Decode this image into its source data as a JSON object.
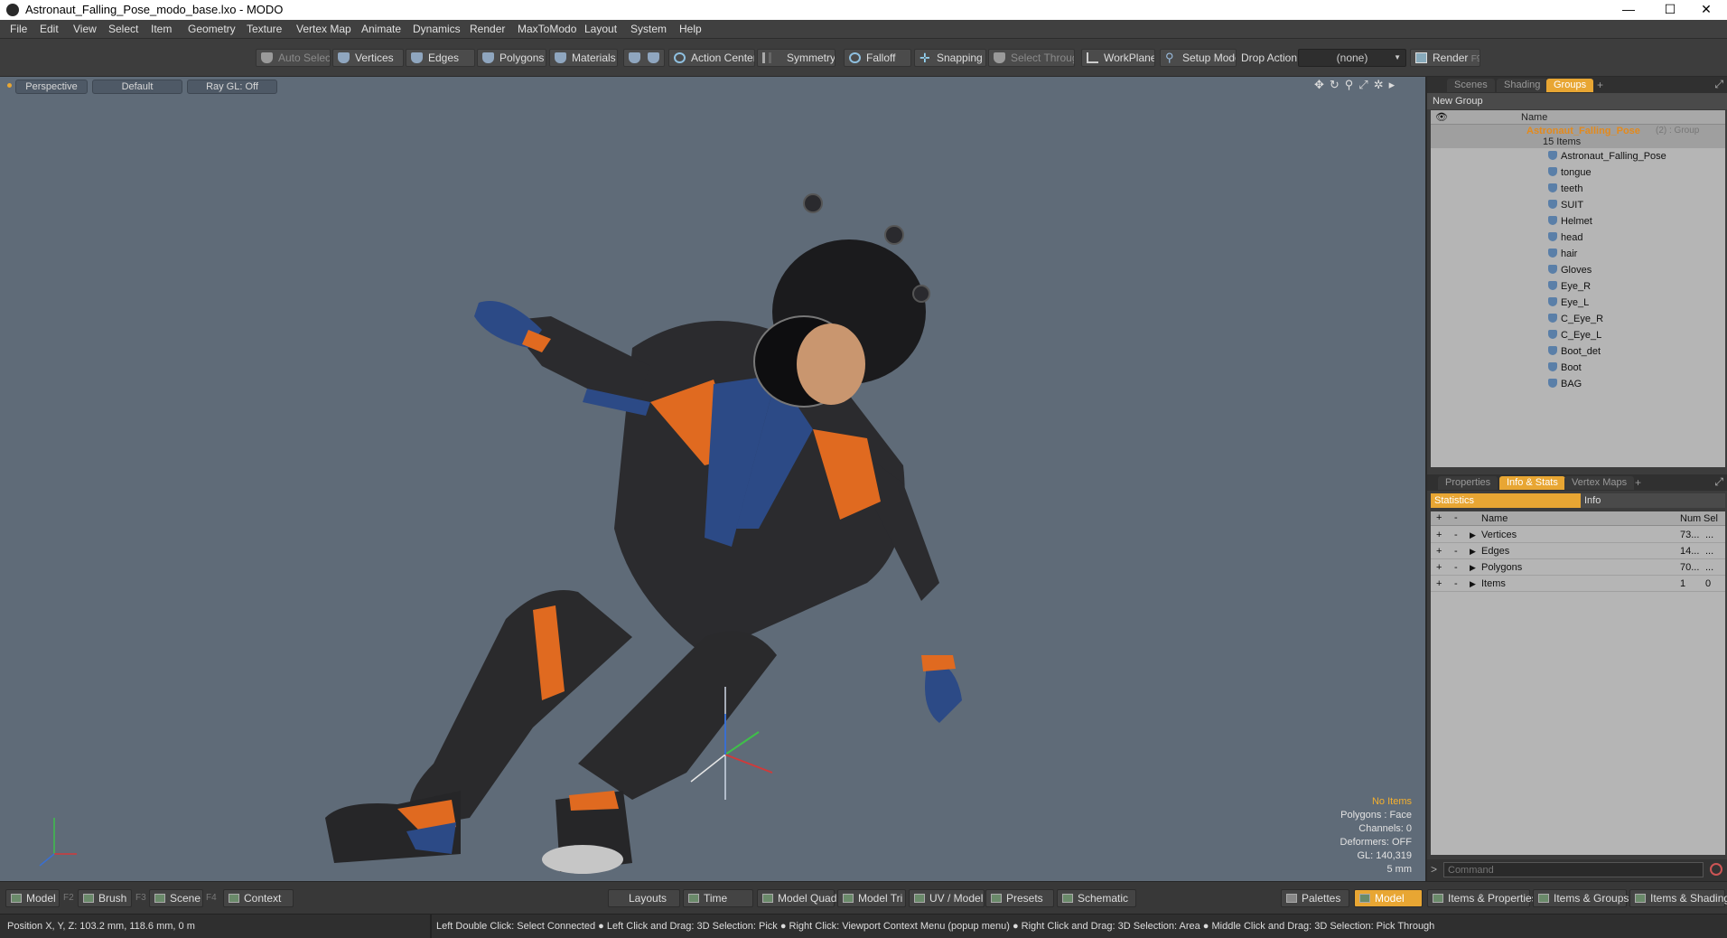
{
  "window": {
    "title": "Astronaut_Falling_Pose_modo_base.lxo - MODO",
    "minimize": "—",
    "maximize": "☐",
    "close": "✕"
  },
  "menu": [
    "File",
    "Edit",
    "View",
    "Select",
    "Item",
    "Geometry",
    "Texture",
    "Vertex Map",
    "Animate",
    "Dynamics",
    "Render",
    "MaxToModo",
    "Layout",
    "System",
    "Help"
  ],
  "toolbar": {
    "auto_select": "Auto Select",
    "vertices": "Vertices",
    "edges": "Edges",
    "polygons": "Polygons",
    "materials": "Materials",
    "action_center": "Action Center",
    "symmetry": "Symmetry",
    "falloff": "Falloff",
    "snapping": "Snapping",
    "select_through": "Select Through",
    "workplane": "WorkPlane",
    "setup_mode": "Setup Mode",
    "drop_action": "Drop Action",
    "drop_value": "(none)",
    "render": "Render",
    "render_key": "F9"
  },
  "viewport": {
    "perspective": "Perspective",
    "default": "Default",
    "ray_gl": "Ray GL: Off",
    "stats": {
      "items": "No Items",
      "polygons": "Polygons : Face",
      "channels": "Channels: 0",
      "deformers": "Deformers: OFF",
      "gl": "GL: 140,319",
      "scale": "5 mm"
    }
  },
  "scene_panel": {
    "tabs": [
      "Scenes",
      "Shading",
      "Groups"
    ],
    "new_group": "New Group",
    "name_header": "Name",
    "group_name": "Astronaut_Falling_Pose",
    "group_suffix": "(2) : Group",
    "count": "15 Items",
    "items": [
      "Astronaut_Falling_Pose",
      "tongue",
      "teeth",
      "SUIT",
      "Helmet",
      "head",
      "hair",
      "Gloves",
      "Eye_R",
      "Eye_L",
      "C_Eye_R",
      "C_Eye_L",
      "Boot_det",
      "Boot",
      "BAG"
    ]
  },
  "props_panel": {
    "tabs": [
      "Properties",
      "Info & Stats",
      "Vertex Maps"
    ],
    "subtabs": [
      "Statistics",
      "Info"
    ],
    "headers": {
      "name": "Name",
      "num": "Num",
      "sel": "Sel"
    },
    "rows": [
      {
        "name": "Vertices",
        "num": "73...",
        "sel": "..."
      },
      {
        "name": "Edges",
        "num": "14...",
        "sel": "..."
      },
      {
        "name": "Polygons",
        "num": "70...",
        "sel": "..."
      },
      {
        "name": "Items",
        "num": "1",
        "sel": "0"
      }
    ],
    "command_placeholder": "Command"
  },
  "bottom": {
    "left": [
      {
        "label": "Model",
        "key": "F2"
      },
      {
        "label": "Brush",
        "key": "F3"
      },
      {
        "label": "Scene",
        "key": "F4"
      },
      {
        "label": "Context",
        "key": ""
      }
    ],
    "center": [
      "Layouts",
      "Time",
      "Model Quad",
      "Model Tri",
      "UV / Model",
      "Presets",
      "Schematic"
    ],
    "right": [
      "Palettes",
      "Model",
      "Items & Properties",
      "Items & Groups",
      "Items & Shading"
    ]
  },
  "status": {
    "position": "Position X, Y, Z:   103.2 mm, 118.6 mm, 0 m",
    "hint": "Left Double Click: Select Connected ● Left Click and Drag: 3D Selection: Pick ● Right Click: Viewport Context Menu (popup menu) ● Right Click and Drag: 3D Selection: Area ● Middle Click and Drag: 3D Selection: Pick Through"
  }
}
